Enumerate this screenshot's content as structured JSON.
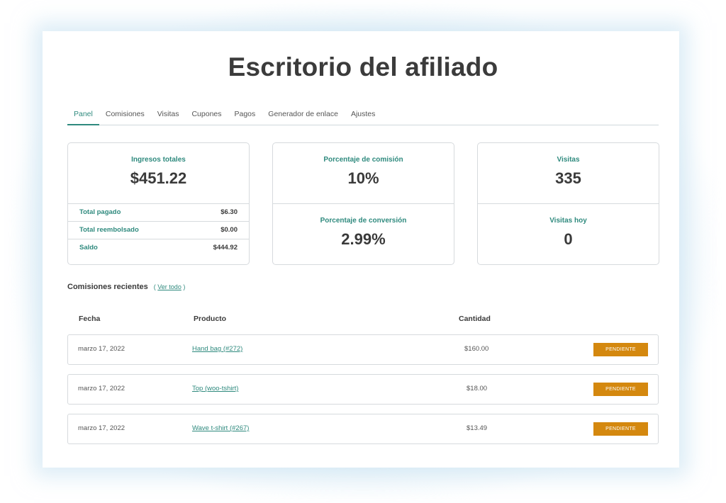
{
  "title": "Escritorio del afiliado",
  "tabs": [
    "Panel",
    "Comisiones",
    "Visitas",
    "Cupones",
    "Pagos",
    "Generador de enlace",
    "Ajustes"
  ],
  "active_tab": "Panel",
  "earnings": {
    "label": "Ingresos totales",
    "value": "$451.22",
    "rows": [
      {
        "label": "Total pagado",
        "value": "$6.30"
      },
      {
        "label": "Total reembolsado",
        "value": "$0.00"
      },
      {
        "label": "Saldo",
        "value": "$444.92"
      }
    ]
  },
  "rates": {
    "commission_label": "Porcentaje de comisión",
    "commission_value": "10%",
    "conversion_label": "Porcentaje de conversión",
    "conversion_value": "2.99%"
  },
  "visits": {
    "total_label": "Visitas",
    "total_value": "335",
    "today_label": "Visitas hoy",
    "today_value": "0"
  },
  "recent": {
    "heading": "Comisiones recientes",
    "open_paren": "(",
    "view_all": "Ver todo",
    "close_paren": ")"
  },
  "table": {
    "headers": {
      "date": "Fecha",
      "product": "Producto",
      "amount": "Cantidad"
    },
    "rows": [
      {
        "date": "marzo 17, 2022",
        "product": "Hand bag (#272)",
        "amount": "$160.00",
        "status": "PENDIENTE"
      },
      {
        "date": "marzo 17, 2022",
        "product": "Top (woo-tshirt)",
        "amount": "$18.00",
        "status": "PENDIENTE"
      },
      {
        "date": "marzo 17, 2022",
        "product": "Wave t-shirt (#267)",
        "amount": "$13.49",
        "status": "PENDIENTE"
      }
    ]
  },
  "colors": {
    "accent": "#2f8a7e",
    "status_pending": "#d4880f",
    "text": "#3a3a3a"
  }
}
